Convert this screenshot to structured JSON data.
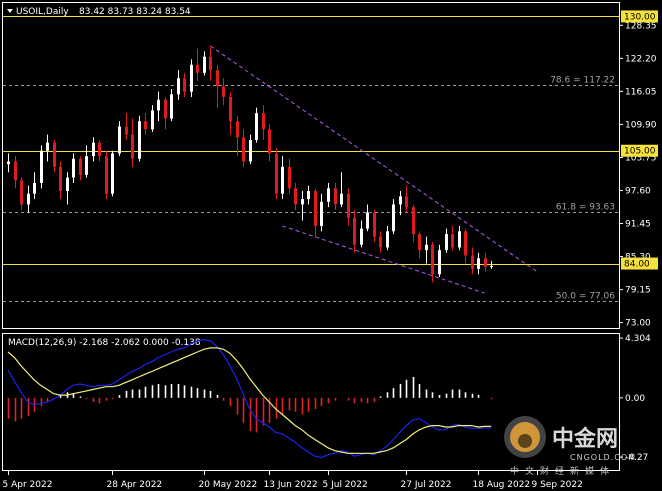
{
  "chart_data": [
    {
      "type": "candlestick",
      "header": {
        "symbol_label": "USOIL,Daily",
        "ohlc_label": "83.42 83.73 83.24 83.54"
      },
      "ylim": [
        72.0,
        132.5
      ],
      "y_ticks": [
        "128.35",
        "122.20",
        "116.05",
        "109.90",
        "103.75",
        "97.60",
        "91.45",
        "85.30",
        "79.15",
        "73.00"
      ],
      "y_tick_values": [
        128.35,
        122.2,
        116.05,
        109.9,
        103.75,
        97.6,
        91.45,
        85.3,
        79.15,
        73.0
      ],
      "horizontal_levels": [
        {
          "value": 130.0,
          "label": "130.00",
          "color": "#f5e13c",
          "style": "solid",
          "boxed": true
        },
        {
          "value": 105.0,
          "label": "105.00",
          "color": "#f5e13c",
          "style": "solid",
          "boxed": true
        },
        {
          "value": 84.0,
          "label": "84.00",
          "color": "#f5e13c",
          "style": "solid",
          "boxed": true
        },
        {
          "value": 117.22,
          "label": "78.6 = 117.22",
          "color": "#9a9a9a",
          "style": "dashed",
          "boxed": false
        },
        {
          "value": 93.63,
          "label": "61.8 = 93.63",
          "color": "#9a9a9a",
          "style": "dashed",
          "boxed": false
        },
        {
          "value": 77.06,
          "label": "50.0 = 77.06",
          "color": "#9a9a9a",
          "style": "dashed",
          "boxed": false
        }
      ],
      "trendlines": [
        {
          "from": {
            "i": 31,
            "v": 124.5
          },
          "to": {
            "i": 81,
            "v": 82.5
          },
          "color": "#b05cf0"
        },
        {
          "from": {
            "i": 42,
            "v": 91.0
          },
          "to": {
            "i": 73,
            "v": 78.5
          },
          "color": "#b05cf0"
        }
      ],
      "current_price": 83.54,
      "candles": [
        [
          102.5,
          104.5,
          101.0,
          103.0
        ],
        [
          103.0,
          104.0,
          98.0,
          99.5
        ],
        [
          99.5,
          100.0,
          94.0,
          95.0
        ],
        [
          95.0,
          98.5,
          93.5,
          97.0
        ],
        [
          97.0,
          101.0,
          96.0,
          99.0
        ],
        [
          99.0,
          106.0,
          98.0,
          105.0
        ],
        [
          105.0,
          108.0,
          103.0,
          106.5
        ],
        [
          106.5,
          107.0,
          101.0,
          102.0
        ],
        [
          102.0,
          103.0,
          96.0,
          97.5
        ],
        [
          97.5,
          101.0,
          95.0,
          100.0
        ],
        [
          100.0,
          104.5,
          99.0,
          103.5
        ],
        [
          103.5,
          104.0,
          99.5,
          100.5
        ],
        [
          100.5,
          106.0,
          100.0,
          104.0
        ],
        [
          104.0,
          107.5,
          103.0,
          106.5
        ],
        [
          106.5,
          107.0,
          103.0,
          104.0
        ],
        [
          104.0,
          105.0,
          96.0,
          97.0
        ],
        [
          97.0,
          105.0,
          96.5,
          104.5
        ],
        [
          104.5,
          110.5,
          104.0,
          109.5
        ],
        [
          109.5,
          112.0,
          107.0,
          108.0
        ],
        [
          108.0,
          111.0,
          102.0,
          103.5
        ],
        [
          103.5,
          111.5,
          103.0,
          110.5
        ],
        [
          110.5,
          112.0,
          108.0,
          109.0
        ],
        [
          109.0,
          113.5,
          108.5,
          112.5
        ],
        [
          112.5,
          116.0,
          110.5,
          114.5
        ],
        [
          114.5,
          115.0,
          109.0,
          111.0
        ],
        [
          111.0,
          116.5,
          110.5,
          115.5
        ],
        [
          115.5,
          120.0,
          114.5,
          118.5
        ],
        [
          118.5,
          119.5,
          115.0,
          116.0
        ],
        [
          116.0,
          122.0,
          115.0,
          121.0
        ],
        [
          121.0,
          124.0,
          118.0,
          119.5
        ],
        [
          119.5,
          123.5,
          119.0,
          122.5
        ],
        [
          122.5,
          124.5,
          118.0,
          120.0
        ],
        [
          120.0,
          121.0,
          113.0,
          117.0
        ],
        [
          117.0,
          118.5,
          113.5,
          115.0
        ],
        [
          115.0,
          116.0,
          108.0,
          110.5
        ],
        [
          110.5,
          111.5,
          104.0,
          107.5
        ],
        [
          107.5,
          109.0,
          102.0,
          103.0
        ],
        [
          103.0,
          108.0,
          102.5,
          107.0
        ],
        [
          107.0,
          113.0,
          106.5,
          112.0
        ],
        [
          112.0,
          113.5,
          107.0,
          109.0
        ],
        [
          109.0,
          110.0,
          103.0,
          104.5
        ],
        [
          104.5,
          105.5,
          96.0,
          97.0
        ],
        [
          97.0,
          104.0,
          96.0,
          102.0
        ],
        [
          102.0,
          103.5,
          97.0,
          98.0
        ],
        [
          98.0,
          99.0,
          94.0,
          95.0
        ],
        [
          95.0,
          97.5,
          92.0,
          96.0
        ],
        [
          96.0,
          98.5,
          95.0,
          97.5
        ],
        [
          97.5,
          98.0,
          89.0,
          91.0
        ],
        [
          91.0,
          97.0,
          90.0,
          95.5
        ],
        [
          95.5,
          99.0,
          94.5,
          98.0
        ],
        [
          98.0,
          99.0,
          94.0,
          95.0
        ],
        [
          95.0,
          101.0,
          94.5,
          97.0
        ],
        [
          97.0,
          98.0,
          91.0,
          92.5
        ],
        [
          92.5,
          94.0,
          86.0,
          87.5
        ],
        [
          87.5,
          92.0,
          87.0,
          90.5
        ],
        [
          90.5,
          95.0,
          90.0,
          93.5
        ],
        [
          93.5,
          94.0,
          88.0,
          89.0
        ],
        [
          89.0,
          90.0,
          86.0,
          87.0
        ],
        [
          87.0,
          91.0,
          86.5,
          90.0
        ],
        [
          90.0,
          96.0,
          89.5,
          95.0
        ],
        [
          95.0,
          97.5,
          93.0,
          96.5
        ],
        [
          96.5,
          98.5,
          93.5,
          94.5
        ],
        [
          94.5,
          95.0,
          88.0,
          89.5
        ],
        [
          89.5,
          90.0,
          85.0,
          86.5
        ],
        [
          86.5,
          89.0,
          84.0,
          87.5
        ],
        [
          87.5,
          88.0,
          80.5,
          82.0
        ],
        [
          82.0,
          87.5,
          81.5,
          86.5
        ],
        [
          86.5,
          90.5,
          86.0,
          89.5
        ],
        [
          89.5,
          91.0,
          86.5,
          87.0
        ],
        [
          87.0,
          91.0,
          86.5,
          90.0
        ],
        [
          90.0,
          90.5,
          84.0,
          85.5
        ],
        [
          85.5,
          87.0,
          82.0,
          83.0
        ],
        [
          83.0,
          86.0,
          82.0,
          85.0
        ],
        [
          85.0,
          86.0,
          82.5,
          83.42
        ],
        [
          83.42,
          84.5,
          83.0,
          83.54
        ]
      ]
    },
    {
      "type": "macd",
      "label": "MACD(12,26,9) -2.168 -2.062 0.000 -0.138",
      "ylim": [
        -5.2,
        4.6
      ],
      "y_ticks": [
        "4.304",
        "0.00",
        "-4.27"
      ],
      "y_tick_values": [
        4.304,
        0.0,
        -4.27
      ],
      "histogram": [
        -1.5,
        -1.7,
        -1.5,
        -1.3,
        -1.0,
        -0.6,
        -0.3,
        0.0,
        0.2,
        0.4,
        0.3,
        0.1,
        -0.1,
        -0.3,
        -0.4,
        -0.2,
        -0.1,
        0.2,
        0.5,
        0.6,
        0.6,
        0.8,
        0.9,
        1.0,
        0.9,
        1.0,
        1.0,
        0.9,
        0.8,
        0.7,
        0.6,
        0.5,
        0.2,
        -0.2,
        -0.6,
        -1.2,
        -1.8,
        -2.4,
        -2.5,
        -2.0,
        -1.8,
        -1.5,
        -1.2,
        -0.9,
        -1.0,
        -1.2,
        -1.0,
        -0.8,
        -0.6,
        -0.4,
        -0.2,
        0.0,
        -0.2,
        -0.4,
        -0.3,
        -0.4,
        -0.3,
        0.1,
        0.4,
        0.7,
        1.0,
        1.3,
        1.5,
        1.0,
        0.6,
        0.4,
        0.2,
        0.3,
        0.6,
        0.6,
        0.4,
        0.3,
        0.2,
        0.0,
        -0.1
      ],
      "macd": [
        2.0,
        1.2,
        0.4,
        -0.3,
        -0.5,
        -0.4,
        -0.3,
        -0.1,
        0.2,
        0.6,
        0.9,
        1.0,
        0.9,
        0.8,
        0.9,
        0.9,
        1.0,
        1.3,
        1.6,
        1.9,
        2.1,
        2.4,
        2.6,
        2.9,
        3.1,
        3.3,
        3.5,
        3.6,
        3.9,
        4.1,
        4.2,
        4.1,
        3.7,
        3.1,
        2.3,
        1.4,
        0.3,
        -0.8,
        -1.5,
        -1.8,
        -2.1,
        -2.5,
        -2.6,
        -2.9,
        -3.2,
        -3.6,
        -3.9,
        -4.2,
        -4.3,
        -4.1,
        -4.0,
        -3.8,
        -3.9,
        -4.2,
        -4.1,
        -4.0,
        -4.1,
        -3.8,
        -3.5,
        -3.0,
        -2.5,
        -2.0,
        -1.6,
        -1.5,
        -1.8,
        -2.1,
        -2.3,
        -2.3,
        -2.0,
        -1.9,
        -2.1,
        -2.2,
        -2.2,
        -2.17,
        -2.17
      ],
      "signal": [
        3.3,
        2.9,
        2.3,
        1.8,
        1.3,
        0.9,
        0.6,
        0.3,
        0.2,
        0.2,
        0.3,
        0.4,
        0.5,
        0.6,
        0.7,
        0.8,
        0.8,
        0.9,
        1.1,
        1.3,
        1.5,
        1.7,
        1.9,
        2.1,
        2.3,
        2.5,
        2.7,
        2.9,
        3.1,
        3.3,
        3.5,
        3.6,
        3.6,
        3.5,
        3.2,
        2.7,
        2.1,
        1.4,
        0.8,
        0.2,
        -0.3,
        -0.8,
        -1.2,
        -1.6,
        -2.0,
        -2.3,
        -2.7,
        -3.0,
        -3.3,
        -3.6,
        -3.8,
        -3.9,
        -4.0,
        -4.0,
        -4.0,
        -4.0,
        -4.0,
        -3.9,
        -3.8,
        -3.6,
        -3.3,
        -3.0,
        -2.6,
        -2.3,
        -2.1,
        -2.0,
        -2.0,
        -2.1,
        -2.1,
        -2.0,
        -2.0,
        -2.0,
        -2.1,
        -2.06,
        -2.06
      ],
      "colors": {
        "macd": "#1d22f0",
        "signal": "#f5f07a",
        "hist_pos": "#ffffff",
        "hist_neg": "#e02424"
      }
    }
  ],
  "x_ticks": [
    {
      "label": "5 Apr 2022",
      "i": 0
    },
    {
      "label": "28 Apr 2022",
      "i": 16
    },
    {
      "label": "20 May 2022",
      "i": 30
    },
    {
      "label": "13 Jun 2022",
      "i": 40
    },
    {
      "label": "5 Jul 2022",
      "i": 49
    },
    {
      "label": "27 Jul 2022",
      "i": 61
    },
    {
      "label": "18 Aug 2022",
      "i": 72
    },
    {
      "label": "9 Sep 2022",
      "i": 81
    }
  ],
  "colors": {
    "background": "#000000",
    "bull": "#ffffff",
    "bear": "#e01b1b",
    "axis": "#ffffff",
    "level_box": "#f5e13c"
  },
  "watermark": {
    "cn_title": "中金网",
    "en_domain": "CNGOLD.COM",
    "cn_sub": "中文财经新媒体"
  }
}
